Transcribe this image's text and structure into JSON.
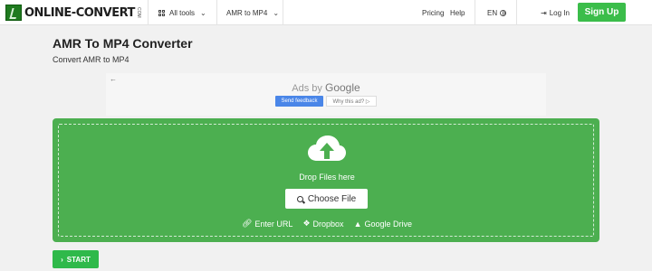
{
  "header": {
    "logo_text": "ONLINE-CONVERT",
    "logo_suffix": "COM",
    "all_tools_label": "All tools",
    "converter_label": "AMR to MP4",
    "pricing_label": "Pricing",
    "help_label": "Help",
    "language_label": "EN",
    "login_label": "Log In",
    "signup_label": "Sign Up"
  },
  "page": {
    "title": "AMR To MP4 Converter",
    "subtitle": "Convert AMR to MP4"
  },
  "ad": {
    "back_icon": "←",
    "label_prefix": "Ads by ",
    "label_brand": "Google",
    "feedback_label": "Send feedback",
    "why_label": "Why this ad? ▷"
  },
  "upload": {
    "drop_text": "Drop Files here",
    "choose_label": "Choose File",
    "sources": [
      {
        "icon": "link-icon",
        "label": "Enter URL"
      },
      {
        "icon": "dropbox-icon",
        "label": "Dropbox"
      },
      {
        "icon": "google-drive-icon",
        "label": "Google Drive"
      }
    ]
  },
  "start_label": "START",
  "colors": {
    "brand_green": "#4caf50",
    "signup_green": "#3bbd4a",
    "feedback_blue": "#4a86e8"
  }
}
